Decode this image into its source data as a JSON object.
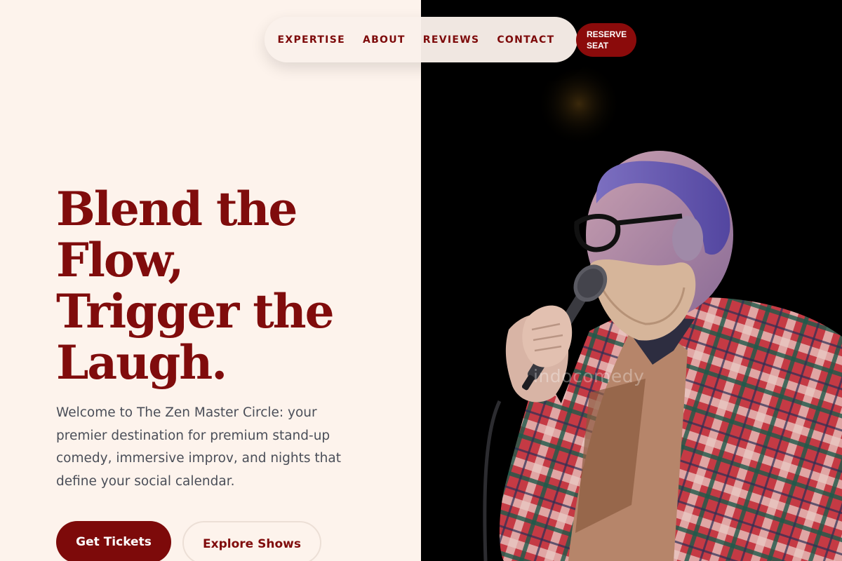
{
  "nav": {
    "links": [
      "EXPERTISE",
      "ABOUT",
      "REVIEWS",
      "CONTACT"
    ],
    "reserve_line1": "RESERVE",
    "reserve_line2": "SEAT"
  },
  "hero": {
    "headline_lines": [
      "Blend the",
      "Flow,",
      "Trigger the",
      "Laugh."
    ],
    "intro": "Welcome to The Zen Master Circle: your premier destination for premium stand-up comedy, immersive improv, and nights that define your social calendar.",
    "primary_cta": "Get Tickets",
    "secondary_cta": "Explore Shows"
  },
  "photo": {
    "watermark": "indocomedy"
  },
  "colors": {
    "brand": "#800c0c",
    "background": "#fdf3ec",
    "photo_background": "#000000",
    "body_text": "#4a4e58"
  }
}
